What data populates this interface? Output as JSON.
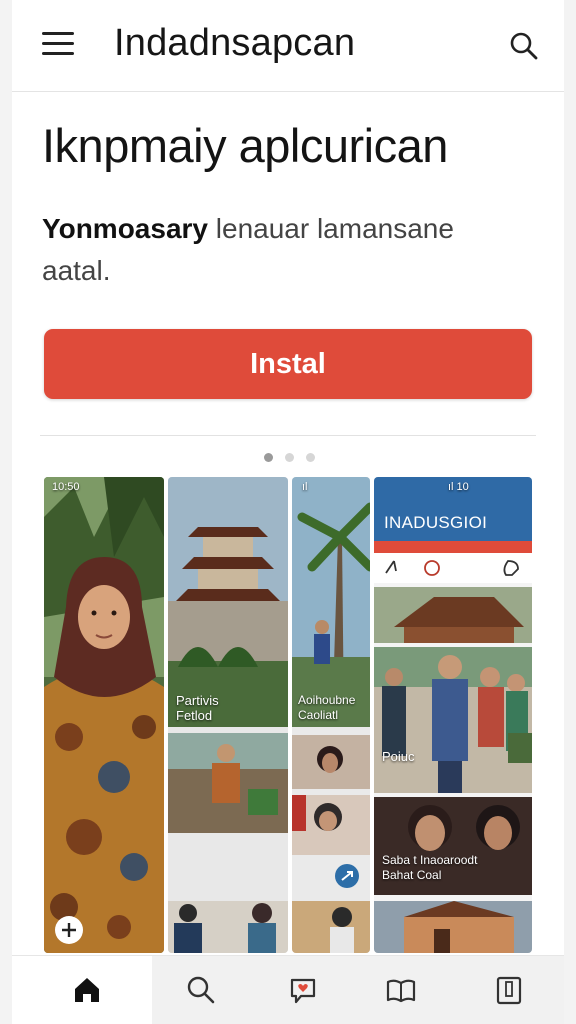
{
  "header": {
    "app_title": "Indadnsapcan",
    "menu_icon": "hamburger-menu-icon",
    "search_icon": "search-icon"
  },
  "hero": {
    "title": "Iknpmaiy aplcurican",
    "description_bold": "Yonmoasary",
    "description_rest": " lenauar lamansane aatal.",
    "install_label": "Instal"
  },
  "carousel": {
    "page_count": 3,
    "active_index": 0
  },
  "gallery": {
    "shot1": {
      "status_text": "10:50",
      "badge_icon": "plus-icon"
    },
    "shot2": {
      "caption_line1": "Partivis",
      "caption_line2": "Fetlod"
    },
    "shot3": {
      "status_text": "ıl",
      "caption_line1": "Aoihoubne",
      "caption_line2": "Caoliatl"
    },
    "shot4": {
      "status_text": "ıl 10",
      "banner_title": "INADUSGIOI",
      "caption_line1": "Poiuc",
      "caption_line2_line1": "Saba t Inaoaroodt",
      "caption_line2_line2": "Bahat Coal"
    }
  },
  "bottom_nav": {
    "items": [
      {
        "icon": "home-icon",
        "active": true
      },
      {
        "icon": "search-icon",
        "active": false
      },
      {
        "icon": "chat-heart-icon",
        "active": false
      },
      {
        "icon": "book-icon",
        "active": false
      },
      {
        "icon": "bookmark-icon",
        "active": false
      }
    ]
  },
  "colors": {
    "accent": "#df4b3a",
    "banner_blue": "#2f6aa6"
  }
}
